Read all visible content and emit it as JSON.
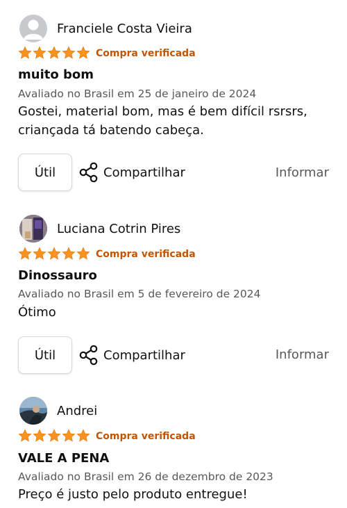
{
  "colors": {
    "star": "#f7931e",
    "verified": "#c45500",
    "meta_text": "#565959"
  },
  "icons": {
    "default_avatar": "user-silhouette-icon",
    "rating_star": "star-icon",
    "share": "share-icon"
  },
  "reviews": [
    {
      "author": "Franciele Costa Vieira",
      "rating": 5,
      "verified_label": "Compra verificada",
      "title": "muito bom",
      "meta": "Avaliado no Brasil em 25 de janeiro de 2024",
      "body": "Gostei, material bom, mas é bem difícil rsrsrs, criançada tá batendo cabeça.",
      "helpful_label": "Útil",
      "share_label": "Compartilhar",
      "report_label": "Informar"
    },
    {
      "author": "Luciana Cotrin Pires",
      "rating": 5,
      "verified_label": "Compra verificada",
      "title": "Dinossauro",
      "meta": "Avaliado no Brasil em 5 de fevereiro de 2024",
      "body": "Ótimo",
      "helpful_label": "Útil",
      "share_label": "Compartilhar",
      "report_label": "Informar"
    },
    {
      "author": "Andrei",
      "rating": 5,
      "verified_label": "Compra verificada",
      "title": "VALE A PENA",
      "meta": "Avaliado no Brasil em 26 de dezembro de 2023",
      "body": "Preço é justo pelo produto entregue!"
    }
  ]
}
